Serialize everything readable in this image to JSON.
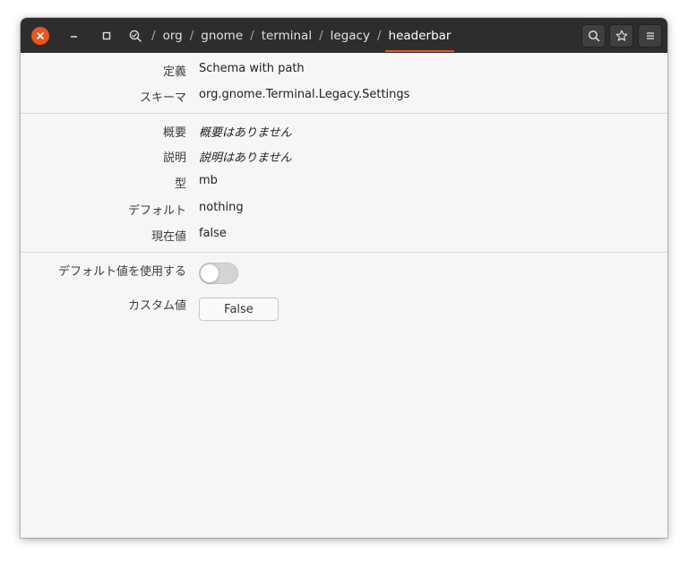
{
  "window": {
    "controls": {
      "close_icon": "close-icon",
      "minimize_icon": "minimize-icon",
      "maximize_icon": "maximize-icon"
    },
    "accent_color": "#e95420"
  },
  "headerbar": {
    "breadcrumbs": [
      {
        "label": "org"
      },
      {
        "label": "gnome"
      },
      {
        "label": "terminal"
      },
      {
        "label": "legacy"
      },
      {
        "label": "headerbar"
      }
    ],
    "separator": "/",
    "buttons": [
      "search-icon",
      "star-icon",
      "menu-icon"
    ]
  },
  "details": {
    "definition": {
      "label": "定義",
      "value": "Schema with path"
    },
    "schema": {
      "label": "スキーマ",
      "value": "org.gnome.Terminal.Legacy.Settings"
    },
    "summary": {
      "label": "概要",
      "value": "概要はありません"
    },
    "description": {
      "label": "説明",
      "value": "説明はありません"
    },
    "type": {
      "label": "型",
      "value": "mb"
    },
    "default": {
      "label": "デフォルト",
      "value": "nothing"
    },
    "current": {
      "label": "現在値",
      "value": "false"
    }
  },
  "settings": {
    "use_default": {
      "label": "デフォルト値を使用する",
      "enabled": false
    },
    "custom_value": {
      "label": "カスタム値",
      "value": "False"
    }
  }
}
